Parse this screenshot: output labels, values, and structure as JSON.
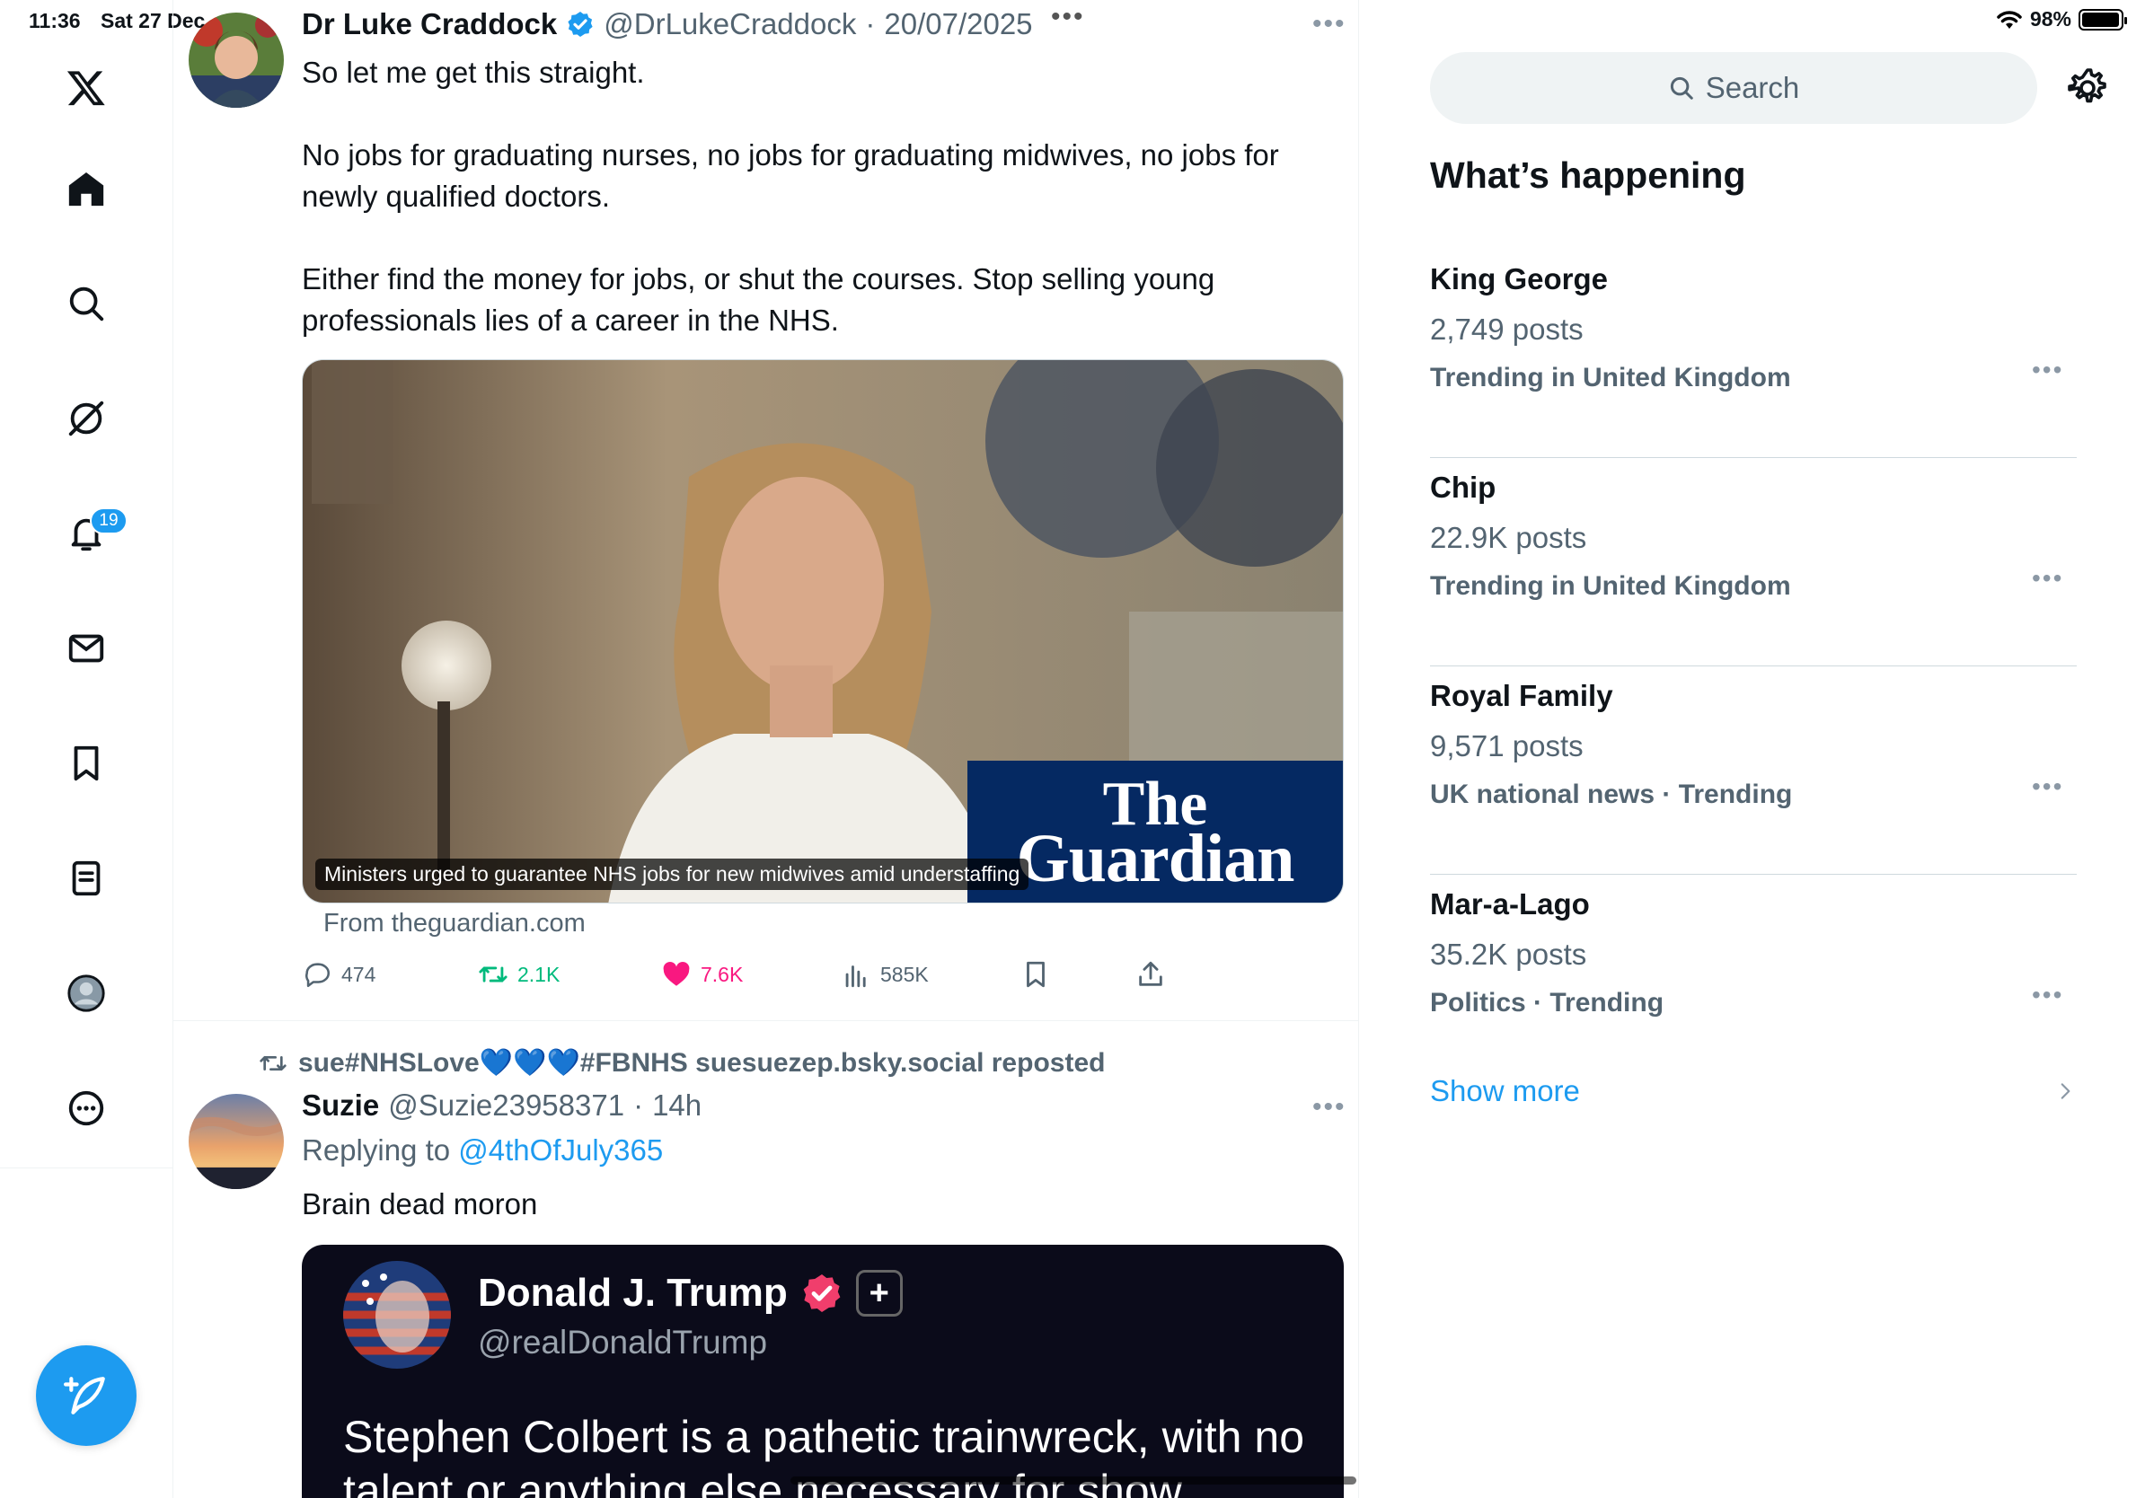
{
  "status": {
    "time": "11:36",
    "date": "Sat 27 Dec",
    "battery": "98%",
    "battery_level": 0.98
  },
  "nav": {
    "notifications_badge": "19"
  },
  "tweet1": {
    "name": "Dr Luke Craddock",
    "handle": "@DrLukeCraddock",
    "sep": "·",
    "date": "20/07/2025",
    "paragraphs": [
      "So let me get this straight.",
      "No jobs for graduating nurses, no jobs for graduating midwives, no jobs for newly qualified doctors.",
      "Either find the money for jobs, or shut the courses. Stop selling young professionals lies of a career in the NHS."
    ],
    "card": {
      "logo_line1": "The",
      "logo_line2": "Guardian",
      "caption": "Ministers urged to guarantee NHS jobs for new midwives amid understaffing",
      "source": "From theguardian.com"
    },
    "actions": {
      "replies": "474",
      "reposts": "2.1K",
      "likes": "7.6K",
      "views": "585K"
    }
  },
  "tweet2": {
    "repost_line": "sue#NHSLove💙💙💙#FBNHS suesuezep.bsky.social reposted",
    "name": "Suzie",
    "handle": "@Suzie23958371",
    "sep": "·",
    "time": "14h",
    "replying_prefix": "Replying to",
    "replying_handle": "@4thOfJuly365",
    "text": "Brain dead moron",
    "embed": {
      "name": "Donald J. Trump",
      "plus": "+",
      "handle": "@realDonaldTrump",
      "text": "Stephen Colbert is a pathetic trainwreck, with no talent or anything else necessary for show"
    }
  },
  "sidebar": {
    "search_placeholder": "Search",
    "title": "What’s happening",
    "trends": [
      {
        "name": "King George",
        "count": "2,749 posts",
        "context": "Trending in United Kingdom"
      },
      {
        "name": "Chip",
        "count": "22.9K posts",
        "context": "Trending in United Kingdom"
      },
      {
        "name": "Royal Family",
        "count": "9,571 posts",
        "context": "UK national news · Trending"
      },
      {
        "name": "Mar-a-Lago",
        "count": "35.2K posts",
        "context": "Politics · Trending"
      }
    ],
    "show_more": "Show more"
  },
  "colors": {
    "accent": "#1d9bf0",
    "repost": "#00ba7c",
    "like": "#f91880",
    "muted": "#536471",
    "guardian": "#052962"
  }
}
